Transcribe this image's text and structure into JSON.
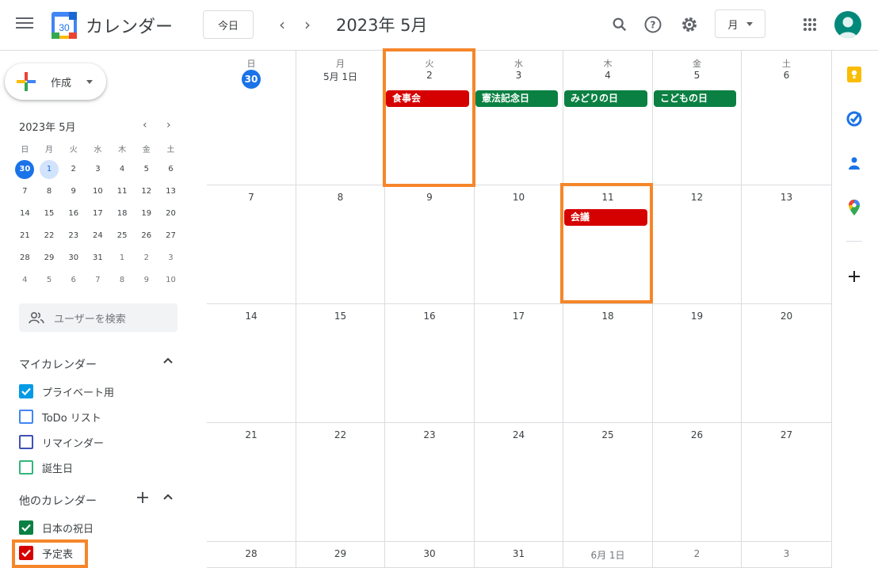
{
  "header": {
    "app_title": "カレンダー",
    "logo_day": "30",
    "today_button": "今日",
    "month_title": "2023年 5月",
    "view_mode": "月",
    "icons": [
      "menu-icon",
      "search-icon",
      "help-icon",
      "gear-icon",
      "apps-grid-icon"
    ]
  },
  "sidebar": {
    "create_label": "作成",
    "mini_title": "2023年 5月",
    "mini_weekdays": [
      "日",
      "月",
      "火",
      "水",
      "木",
      "金",
      "土"
    ],
    "mini_weeks": [
      [
        "30",
        "1",
        "2",
        "3",
        "4",
        "5",
        "6"
      ],
      [
        "7",
        "8",
        "9",
        "10",
        "11",
        "12",
        "13"
      ],
      [
        "14",
        "15",
        "16",
        "17",
        "18",
        "19",
        "20"
      ],
      [
        "21",
        "22",
        "23",
        "24",
        "25",
        "26",
        "27"
      ],
      [
        "28",
        "29",
        "30",
        "31",
        "1",
        "2",
        "3"
      ],
      [
        "4",
        "5",
        "6",
        "7",
        "8",
        "9",
        "10"
      ]
    ],
    "people_search_placeholder": "ユーザーを検索",
    "my_calendars_title": "マイカレンダー",
    "my_calendars": [
      {
        "label": "プライベート用",
        "color": "#039be5",
        "checked": true
      },
      {
        "label": "ToDo リスト",
        "color": "#4285f4",
        "checked": false
      },
      {
        "label": "リマインダー",
        "color": "#3f51b5",
        "checked": false
      },
      {
        "label": "誕生日",
        "color": "#33b679",
        "checked": false
      }
    ],
    "other_calendars_title": "他のカレンダー",
    "other_calendars": [
      {
        "label": "日本の祝日",
        "color": "#0b8043",
        "checked": true
      },
      {
        "label": "予定表",
        "color": "#d50000",
        "checked": true
      }
    ]
  },
  "month_grid": {
    "weekdays": [
      "日",
      "月",
      "火",
      "水",
      "木",
      "金",
      "土"
    ],
    "weeks": [
      [
        "30",
        "5月 1日",
        "2",
        "3",
        "4",
        "5",
        "6"
      ],
      [
        "7",
        "8",
        "9",
        "10",
        "11",
        "12",
        "13"
      ],
      [
        "14",
        "15",
        "16",
        "17",
        "18",
        "19",
        "20"
      ],
      [
        "21",
        "22",
        "23",
        "24",
        "25",
        "26",
        "27"
      ],
      [
        "28",
        "29",
        "30",
        "31",
        "6月 1日",
        "2",
        "3"
      ]
    ],
    "events": [
      {
        "title": "食事会",
        "week": 0,
        "day": 2,
        "color": "#d50000"
      },
      {
        "title": "憲法記念日",
        "week": 0,
        "day": 3,
        "color": "#0b8043"
      },
      {
        "title": "みどりの日",
        "week": 0,
        "day": 4,
        "color": "#0b8043"
      },
      {
        "title": "こどもの日",
        "week": 0,
        "day": 5,
        "color": "#0b8043"
      },
      {
        "title": "会議",
        "week": 1,
        "day": 4,
        "color": "#d50000"
      }
    ]
  },
  "highlight_color": "#f5862a"
}
